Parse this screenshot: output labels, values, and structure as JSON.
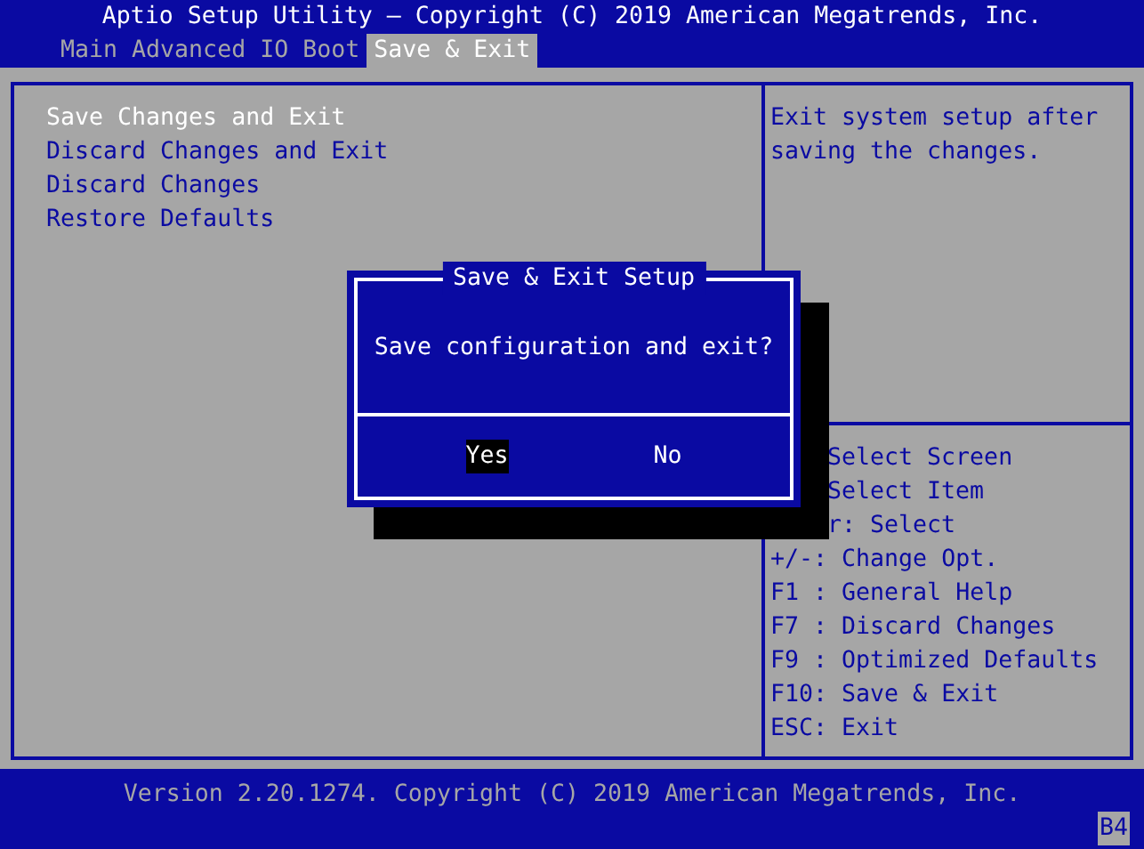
{
  "title": "Aptio Setup Utility – Copyright (C) 2019 American Megatrends, Inc.",
  "tabs": [
    {
      "label": "Main",
      "selected": false
    },
    {
      "label": "Advanced",
      "selected": false
    },
    {
      "label": "IO",
      "selected": false
    },
    {
      "label": "Boot",
      "selected": false
    },
    {
      "label": "Save & Exit",
      "selected": true
    }
  ],
  "menu_items": [
    {
      "label": "Save Changes and Exit",
      "selected": true
    },
    {
      "label": "Discard Changes and Exit",
      "selected": false
    },
    {
      "label": "Discard Changes",
      "selected": false
    },
    {
      "label": "Restore Defaults",
      "selected": false
    }
  ],
  "description": "Exit system setup after saving the changes.",
  "help_lines": [
    {
      "text": "Select Screen",
      "kind": "covered"
    },
    {
      "text": "Select Item",
      "kind": "covered"
    },
    {
      "text": "r: Select",
      "kind": "covered"
    },
    {
      "text": "+/-: Change Opt.",
      "kind": "key"
    },
    {
      "text": "F1 : General Help",
      "kind": "key"
    },
    {
      "text": "F7 : Discard Changes",
      "kind": "key"
    },
    {
      "text": "F9 : Optimized Defaults",
      "kind": "key"
    },
    {
      "text": "F10: Save & Exit",
      "kind": "key"
    },
    {
      "text": "ESC: Exit",
      "kind": "key"
    }
  ],
  "dialog": {
    "title": "Save & Exit Setup",
    "message": "Save configuration and exit?",
    "buttons": [
      {
        "label": "Yes",
        "selected": true
      },
      {
        "label": "No",
        "selected": false
      }
    ]
  },
  "footer": "Version 2.20.1274. Copyright (C) 2019 American Megatrends, Inc.",
  "corner_code": "B4"
}
